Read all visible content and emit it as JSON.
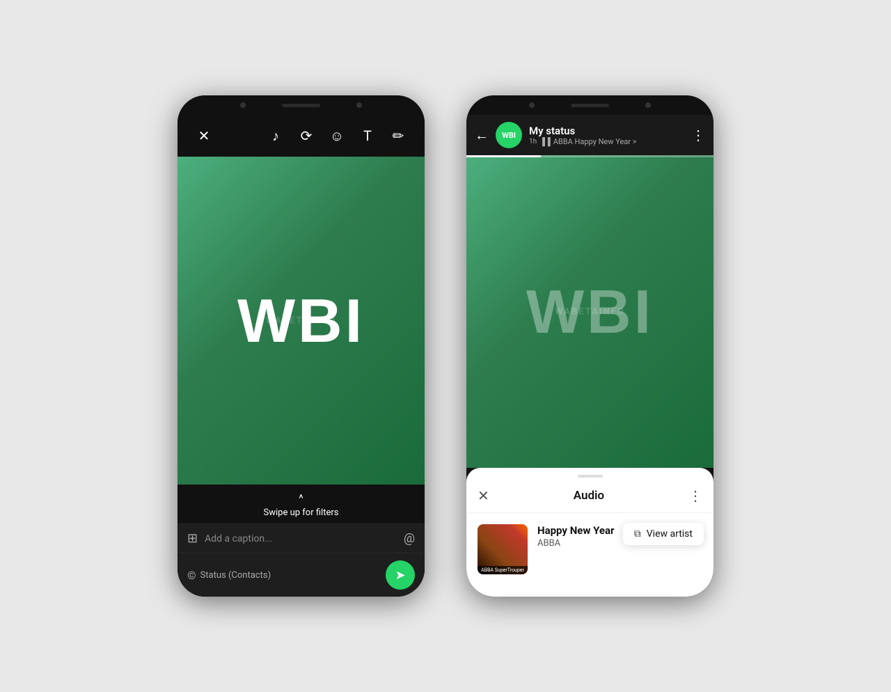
{
  "left_phone": {
    "toolbar": {
      "close_icon": "✕",
      "music_icon": "♪",
      "crop_icon": "⟳",
      "sticker_icon": "☺",
      "text_icon": "T",
      "draw_icon": "✏"
    },
    "wbi_logo": "WBI",
    "swipe": {
      "arrow": "^",
      "text": "Swipe up for filters"
    },
    "caption": {
      "icon": "⊞",
      "placeholder": "Add a caption...",
      "mention_icon": "@"
    },
    "status": {
      "label": "Status (Contacts)",
      "icon": "©"
    },
    "send_icon": "➤"
  },
  "right_phone": {
    "header": {
      "back_icon": "←",
      "avatar_text": "WBI",
      "title": "My status",
      "time": "1h",
      "bar_icon": "▐▐",
      "song_preview": "ABBA Happy New Year >",
      "more_icon": "⋮"
    },
    "wbi_logo": "WBI",
    "bottom_sheet": {
      "handle": "",
      "close_icon": "✕",
      "title": "Audio",
      "more_icon": "⋮",
      "album_label": "ABBA SuperTrouper",
      "song_title": "Happy New Year",
      "artist": "ABBA",
      "context_menu": {
        "icon": "⧉",
        "label": "View artist"
      }
    }
  },
  "watermark": "WABETAINFO"
}
